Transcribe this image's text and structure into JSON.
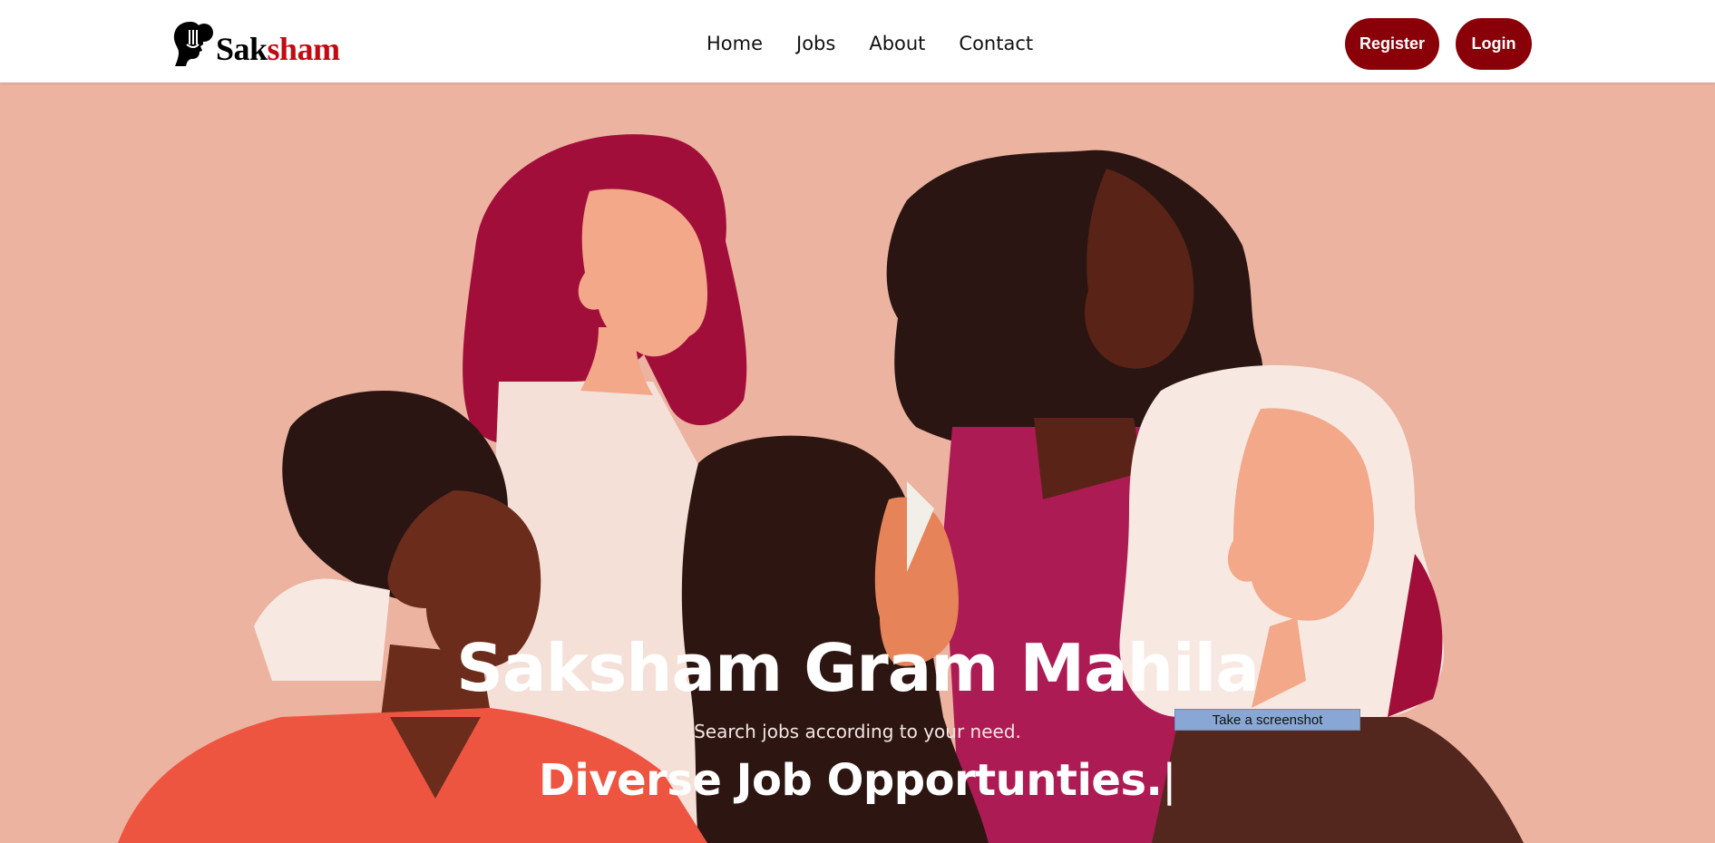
{
  "brand": {
    "part1": "Sak",
    "part2": "sham",
    "color_primary": "#000000",
    "color_accent": "#c20a13"
  },
  "nav": {
    "items": [
      "Home",
      "Jobs",
      "About",
      "Contact"
    ]
  },
  "buttons": {
    "register": "Register",
    "login": "Login",
    "color": "#8a0008"
  },
  "hero": {
    "title": "Saksham Gram Mahila",
    "subtitle": "Search jobs according to your need.",
    "typed_text": "Diverse Job Opportunties.",
    "cursor": "|"
  },
  "tooltip": {
    "text": "Take a screenshot"
  },
  "icons": {
    "logo": "woman-profile-logo-icon"
  }
}
